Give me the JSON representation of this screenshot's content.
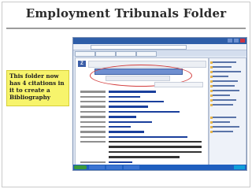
{
  "slide": {
    "title": "Employment Tribunals Folder",
    "callout": "This folder now has 4 citations in it to create a Bibliography"
  }
}
